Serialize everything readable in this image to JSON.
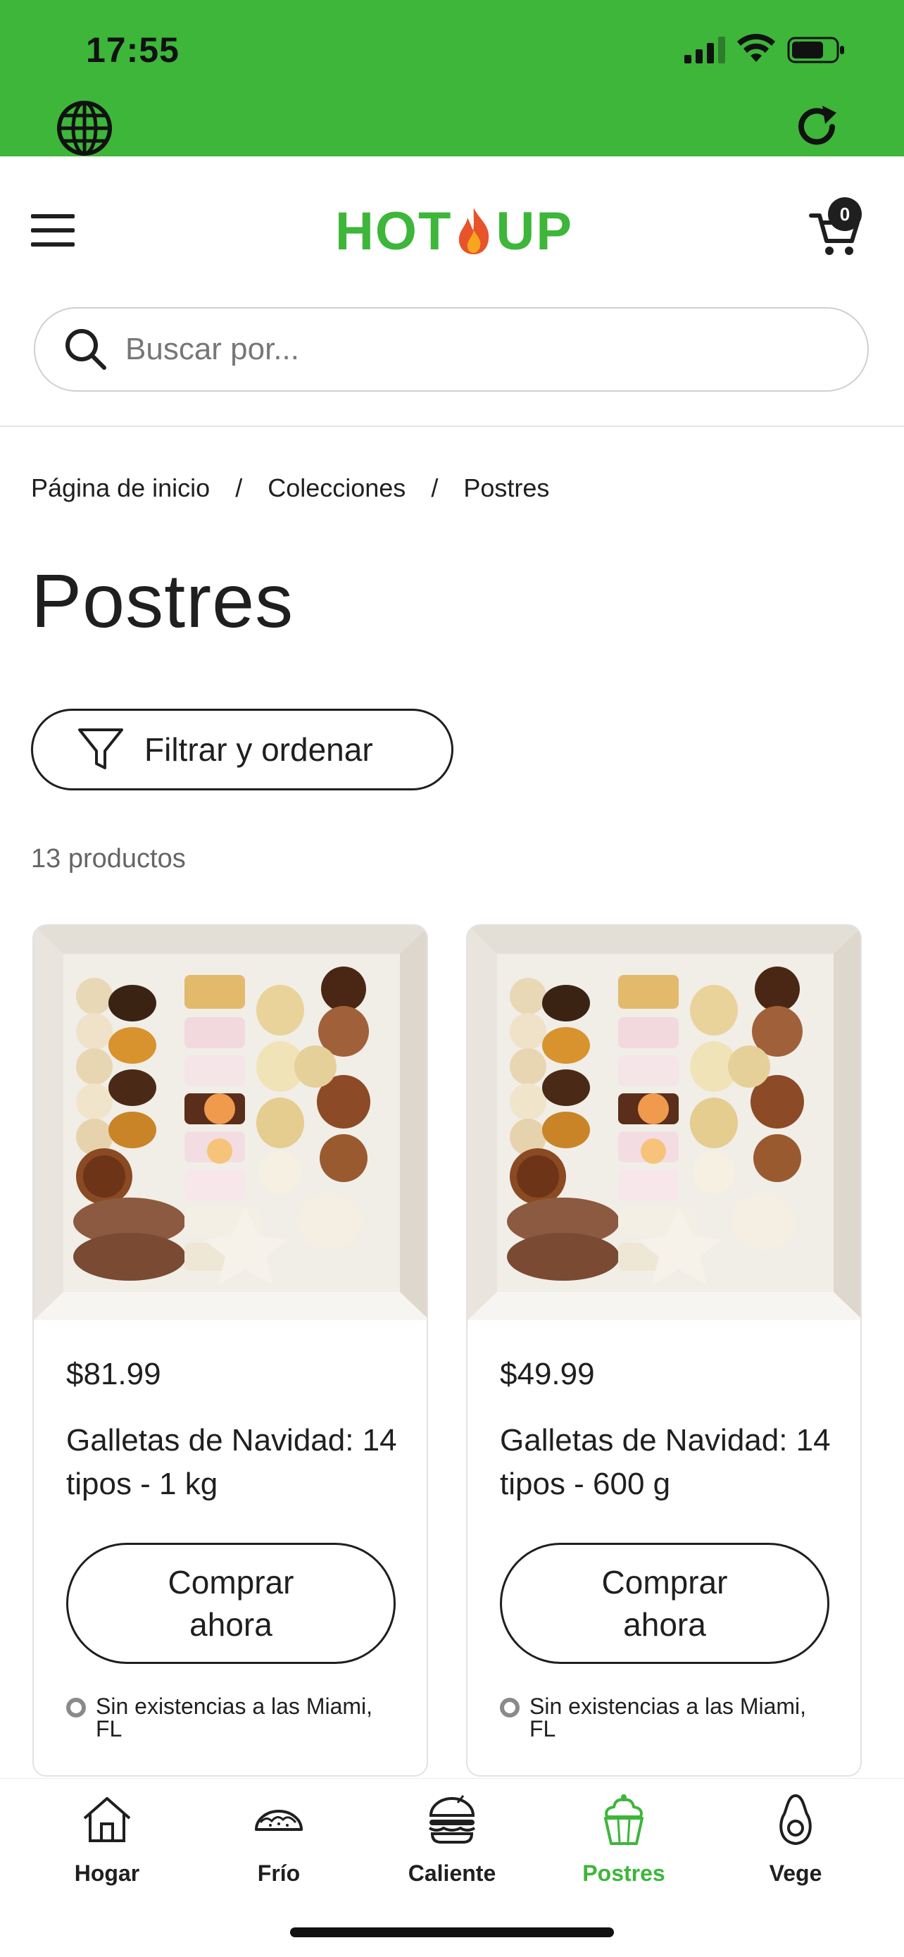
{
  "status_bar": {
    "time": "17:55"
  },
  "header": {
    "logo_left": "HOT",
    "logo_right": "UP",
    "cart_count": "0",
    "search_placeholder": "Buscar por..."
  },
  "breadcrumb": {
    "items": [
      "Página de inicio",
      "Colecciones",
      "Postres"
    ],
    "separator": "/"
  },
  "page": {
    "title": "Postres",
    "filter_label": "Filtrar y ordenar",
    "product_count": "13 productos"
  },
  "products": [
    {
      "price": "$81.99",
      "name": "Galletas de Navidad: 14 tipos - 1 kg",
      "button": "Comprar ahora",
      "stock": "Sin existencias a las Miami, FL"
    },
    {
      "price": "$49.99",
      "name": "Galletas de Navidad: 14 tipos - 600 g",
      "button": "Comprar ahora",
      "stock": "Sin existencias a las Miami, FL"
    }
  ],
  "bottom_nav": {
    "items": [
      {
        "label": "Hogar",
        "icon": "house-icon",
        "active": false
      },
      {
        "label": "Frío",
        "icon": "taco-icon",
        "active": false
      },
      {
        "label": "Caliente",
        "icon": "burger-icon",
        "active": false
      },
      {
        "label": "Postres",
        "icon": "cupcake-icon",
        "active": true
      },
      {
        "label": "Vege",
        "icon": "avocado-icon",
        "active": false
      }
    ]
  },
  "colors": {
    "brand": "#3db63a",
    "text": "#1f1f1f",
    "muted": "#666666"
  }
}
